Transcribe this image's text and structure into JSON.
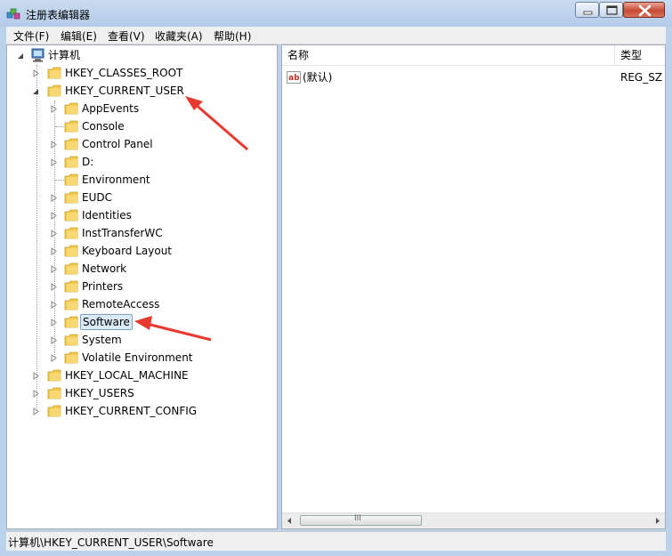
{
  "window": {
    "title": "注册表编辑器"
  },
  "menu": [
    "文件(F)",
    "编辑(E)",
    "查看(V)",
    "收藏夹(A)",
    "帮助(H)"
  ],
  "tree": {
    "root": "计算机",
    "hives": [
      {
        "label": "HKEY_CLASSES_ROOT",
        "expanded": false
      },
      {
        "label": "HKEY_CURRENT_USER",
        "expanded": true
      },
      {
        "label": "HKEY_LOCAL_MACHINE",
        "expanded": false
      },
      {
        "label": "HKEY_USERS",
        "expanded": false
      },
      {
        "label": "HKEY_CURRENT_CONFIG",
        "expanded": false
      }
    ],
    "current_user_children": [
      {
        "label": "AppEvents",
        "has_children": true
      },
      {
        "label": "Console",
        "has_children": false
      },
      {
        "label": "Control Panel",
        "has_children": true
      },
      {
        "label": "D:",
        "has_children": true
      },
      {
        "label": "Environment",
        "has_children": false
      },
      {
        "label": "EUDC",
        "has_children": true
      },
      {
        "label": "Identities",
        "has_children": true
      },
      {
        "label": "InstTransferWC",
        "has_children": true
      },
      {
        "label": "Keyboard Layout",
        "has_children": true
      },
      {
        "label": "Network",
        "has_children": true
      },
      {
        "label": "Printers",
        "has_children": true
      },
      {
        "label": "RemoteAccess",
        "has_children": true
      },
      {
        "label": "Software",
        "has_children": true,
        "selected": true
      },
      {
        "label": "System",
        "has_children": true
      },
      {
        "label": "Volatile Environment",
        "has_children": true
      }
    ]
  },
  "values_list": {
    "columns": [
      "名称",
      "类型"
    ],
    "rows": [
      {
        "name": "(默认)",
        "type": "REG_SZ",
        "icon": "ab-string-icon"
      }
    ]
  },
  "scrollbar": {
    "thumb_glyph": "III"
  },
  "statusbar": {
    "path": "计算机\\HKEY_CURRENT_USER\\Software"
  },
  "colors": {
    "accent_arrow": "#e8392f",
    "selection": "#dbeaf9",
    "folder": "#f2c94c"
  }
}
